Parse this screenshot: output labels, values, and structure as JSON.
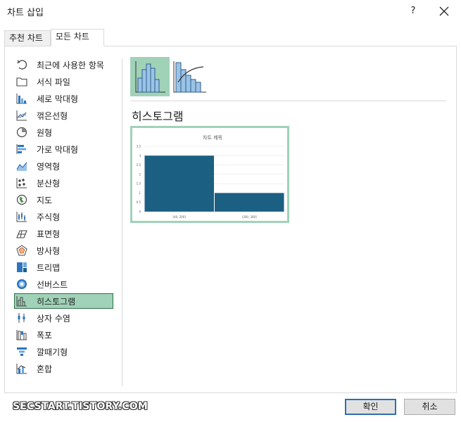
{
  "window": {
    "title": "차트 삽입",
    "help_label": "?"
  },
  "tabs": [
    {
      "label": "추천 차트",
      "active": false
    },
    {
      "label": "모든 차트",
      "active": true
    }
  ],
  "categories": [
    {
      "label": "최근에 사용한 항목",
      "icon": "recent-icon"
    },
    {
      "label": "서식 파일",
      "icon": "folder-icon"
    },
    {
      "label": "세로 막대형",
      "icon": "column-chart-icon"
    },
    {
      "label": "꺾은선형",
      "icon": "line-chart-icon"
    },
    {
      "label": "원형",
      "icon": "pie-chart-icon"
    },
    {
      "label": "가로 막대형",
      "icon": "bar-chart-icon"
    },
    {
      "label": "영역형",
      "icon": "area-chart-icon"
    },
    {
      "label": "분산형",
      "icon": "scatter-chart-icon"
    },
    {
      "label": "지도",
      "icon": "map-chart-icon"
    },
    {
      "label": "주식형",
      "icon": "stock-chart-icon"
    },
    {
      "label": "표면형",
      "icon": "surface-chart-icon"
    },
    {
      "label": "방사형",
      "icon": "radar-chart-icon"
    },
    {
      "label": "트리맵",
      "icon": "treemap-chart-icon"
    },
    {
      "label": "선버스트",
      "icon": "sunburst-chart-icon"
    },
    {
      "label": "히스토그램",
      "icon": "histogram-chart-icon",
      "selected": true
    },
    {
      "label": "상자 수염",
      "icon": "box-whisker-chart-icon"
    },
    {
      "label": "폭포",
      "icon": "waterfall-chart-icon"
    },
    {
      "label": "깔때기형",
      "icon": "funnel-chart-icon"
    },
    {
      "label": "혼합",
      "icon": "combo-chart-icon"
    }
  ],
  "subtypes": [
    {
      "name": "histogram",
      "selected": true
    },
    {
      "name": "pareto",
      "selected": false
    }
  ],
  "selected_heading": "히스토그램",
  "preview": {
    "title": "차트 제목",
    "yticks": [
      "3.5",
      "3",
      "2.5",
      "2",
      "1.5",
      "1",
      "0.5",
      "0"
    ],
    "categories": [
      "[40, 200]",
      "(200, 360]"
    ],
    "values": [
      3,
      1
    ]
  },
  "watermark": "SECSTART.TISTORY.COM",
  "buttons": {
    "ok": "확인",
    "cancel": "취소"
  },
  "colors": {
    "accent_selected": "#a0d2b8",
    "bar_fill": "#1b5f82",
    "icon_blue": "#2b75c0"
  }
}
